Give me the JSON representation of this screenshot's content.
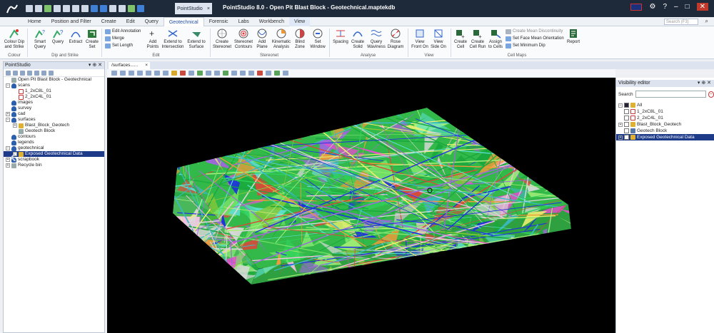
{
  "window": {
    "app_title": "PointStudio 8.0 - Open Pit Blast Block - Geotechnical.maptekdb",
    "doc_tab": "PointStudio",
    "close_glyph": "×"
  },
  "ribbon_tabs": [
    "Home",
    "Position and Filter",
    "Create",
    "Edit",
    "Query",
    "Geotechnical",
    "Forensic",
    "Labs",
    "Workbench",
    "View"
  ],
  "active_tab": "Geotechnical",
  "search_placeholder": "Search (F3)",
  "ribbon": {
    "colour": {
      "label": "Colour",
      "buttons": [
        {
          "label": "Colour Dip\nand Strike"
        }
      ]
    },
    "dip_strike": {
      "label": "Dip and Strike",
      "buttons": [
        {
          "label": "Smart\nQuery"
        },
        {
          "label": "Query"
        },
        {
          "label": "Extract"
        },
        {
          "label": "Create\nSet"
        }
      ]
    },
    "edit": {
      "label": "Edit",
      "small": [
        "Edit Annotation",
        "Merge",
        "Set Length"
      ],
      "buttons": [
        {
          "label": "Add\nPoints"
        },
        {
          "label": "Extend to\nIntersection"
        },
        {
          "label": "Extend to\nSurface"
        }
      ]
    },
    "stereonet": {
      "label": "Stereonet",
      "buttons": [
        {
          "label": "Create\nStereonet"
        },
        {
          "label": "Stereonet\nContours"
        },
        {
          "label": "Add\nPlane"
        },
        {
          "label": "Kinematic\nAnalysis"
        },
        {
          "label": "Blind\nZone"
        },
        {
          "label": "Set\nWindow"
        }
      ]
    },
    "analyse": {
      "label": "Analyse",
      "buttons": [
        {
          "label": "Spacing"
        },
        {
          "label": "Create\nSolid"
        },
        {
          "label": "Query\nWaviness"
        },
        {
          "label": "Rose\nDiagram"
        }
      ]
    },
    "view": {
      "label": "View",
      "buttons": [
        {
          "label": "View\nFront On"
        },
        {
          "label": "View\nSide On"
        }
      ]
    },
    "cell_maps": {
      "label": "Cell Maps",
      "buttons": [
        {
          "label": "Create\nCell"
        },
        {
          "label": "Create\nCell Run"
        },
        {
          "label": "Assign\nto Cells"
        }
      ],
      "small": [
        "Create Mean Discontinuity",
        "Set Face Mean Orientation",
        "Set Minimum Dip"
      ],
      "report": "Report"
    }
  },
  "left_panel": {
    "title": "PointStudio",
    "tree": [
      {
        "label": "Open Pit Blast Block - Geotechnical",
        "level": 0,
        "icon": "page-icon",
        "expander": ""
      },
      {
        "label": "scans",
        "level": 0,
        "icon": "database-icon",
        "expander": "−"
      },
      {
        "label": "1_2xC8L_01",
        "level": 1,
        "icon": "scan-icon",
        "expander": ""
      },
      {
        "label": "2_2xC4L_01",
        "level": 1,
        "icon": "scan-icon",
        "expander": ""
      },
      {
        "label": "images",
        "level": 0,
        "icon": "database-icon",
        "expander": ""
      },
      {
        "label": "survey",
        "level": 0,
        "icon": "database-icon",
        "expander": ""
      },
      {
        "label": "cad",
        "level": 0,
        "icon": "database-icon",
        "expander": "+"
      },
      {
        "label": "surfaces",
        "level": 0,
        "icon": "database-icon",
        "expander": "−"
      },
      {
        "label": "Blast_Block_Geotech",
        "level": 1,
        "icon": "surface-icon",
        "expander": "+"
      },
      {
        "label": "Geotech Block",
        "level": 1,
        "icon": "block-icon",
        "expander": ""
      },
      {
        "label": "contours",
        "level": 0,
        "icon": "database-icon",
        "expander": ""
      },
      {
        "label": "legends",
        "level": 0,
        "icon": "database-icon",
        "expander": ""
      },
      {
        "label": "geotechnical",
        "level": 0,
        "icon": "database-icon",
        "expander": "−"
      },
      {
        "label": "Exposed Geotechnical Data",
        "level": 1,
        "icon": "geotech-data-icon",
        "expander": "+",
        "selected": true
      },
      {
        "label": "scrapbook",
        "level": 0,
        "icon": "database-icon",
        "expander": "+"
      },
      {
        "label": "Recycle bin",
        "level": 0,
        "icon": "recycle-bin-icon",
        "expander": "+"
      }
    ]
  },
  "view_tab": "/surfaces......",
  "visibility": {
    "title": "Visibility editor",
    "search_label": "Search",
    "tree": [
      {
        "label": "All",
        "checked": "partial",
        "expander": "−",
        "icon": "folder-icon",
        "level": 0
      },
      {
        "label": "1_2xC8L_01",
        "checked": false,
        "expander": "",
        "icon": "scan-icon",
        "level": 1
      },
      {
        "label": "2_2xC4L_01",
        "checked": false,
        "expander": "",
        "icon": "scan-icon",
        "level": 1
      },
      {
        "label": "Blast_Block_Geotech",
        "checked": false,
        "expander": "+",
        "icon": "surface-icon",
        "level": 1
      },
      {
        "label": "Geotech Block",
        "checked": false,
        "expander": "",
        "icon": "block-icon",
        "level": 1
      },
      {
        "label": "Exposed Geotechnical Data",
        "checked": true,
        "expander": "+",
        "icon": "geotech-data-icon",
        "level": 1,
        "selected": true
      }
    ]
  }
}
